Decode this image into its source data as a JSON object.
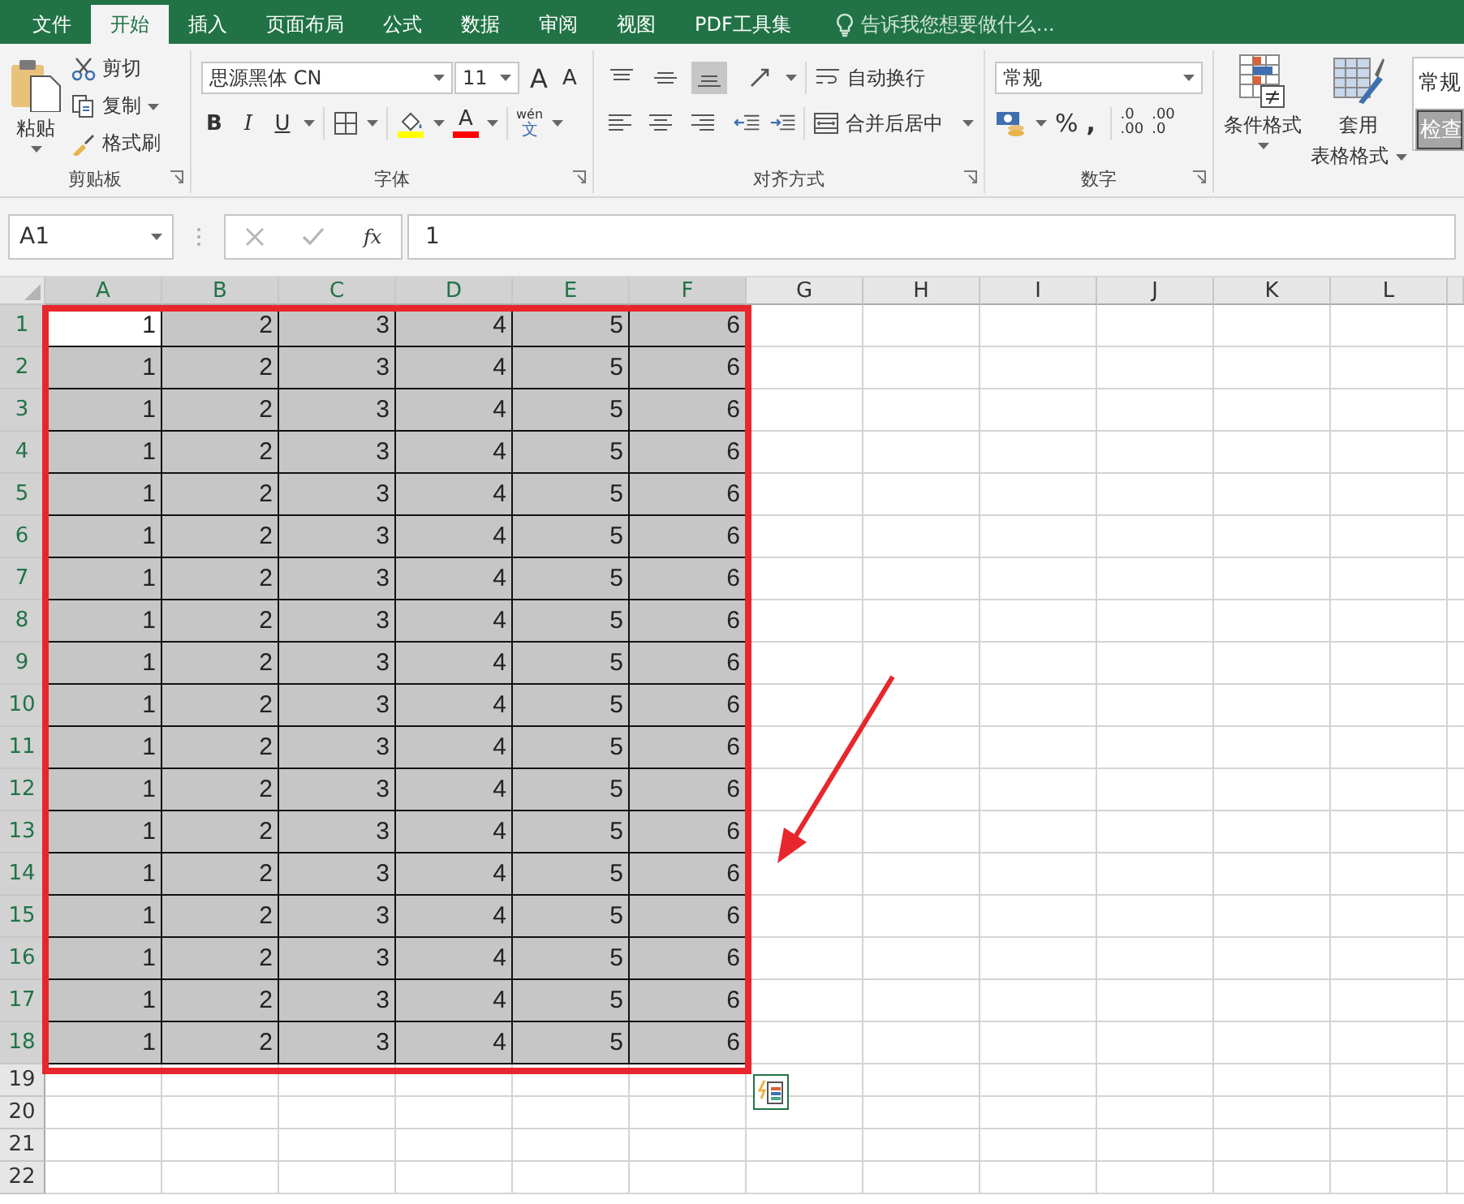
{
  "tabs": [
    {
      "label": "文件",
      "selected": false
    },
    {
      "label": "开始",
      "selected": true
    },
    {
      "label": "插入",
      "selected": false
    },
    {
      "label": "页面布局",
      "selected": false
    },
    {
      "label": "公式",
      "selected": false
    },
    {
      "label": "数据",
      "selected": false
    },
    {
      "label": "审阅",
      "selected": false
    },
    {
      "label": "视图",
      "selected": false
    },
    {
      "label": "PDF工具集",
      "selected": false
    }
  ],
  "tell_me": {
    "placeholder": "告诉我您想要做什么..."
  },
  "ribbon": {
    "clipboard": {
      "label": "剪贴板",
      "paste": "粘贴",
      "cut": "剪切",
      "copy": "复制",
      "format_painter": "格式刷"
    },
    "font": {
      "label": "字体",
      "font_name": "思源黑体 CN",
      "font_size": "11",
      "size_buttons": [
        "A",
        "A"
      ],
      "style_buttons": [
        "B",
        "I",
        "U"
      ],
      "font_color": {
        "label": "A"
      },
      "phonetic": {
        "top": "wén",
        "bottom": "文"
      }
    },
    "alignment": {
      "label": "对齐方式",
      "vertical_align": [
        {
          "selected": false
        },
        {
          "selected": false
        },
        {
          "selected": true
        }
      ],
      "horizontal_align": [
        {
          "selected": false
        },
        {
          "selected": false
        },
        {
          "selected": false
        }
      ],
      "wrap_text": "自动换行",
      "merge_center": "合并后居中"
    },
    "number": {
      "label": "数字",
      "format": "常规",
      "percent": "%",
      "comma": ",",
      "decimals": [
        {
          "top": ".0",
          "bottom": ".00"
        },
        {
          "top": ".00",
          "bottom": ".0"
        }
      ]
    },
    "styles": {
      "conditional": "条件格式",
      "table_format": [
        "套用",
        "表格格式"
      ],
      "cell_styles": [
        "常规",
        "检查"
      ]
    }
  },
  "formula_bar": {
    "name_box": "A1",
    "fx": "fx",
    "value": "1"
  },
  "sheet": {
    "columns": [
      {
        "label": "A",
        "selected": true
      },
      {
        "label": "B",
        "selected": true
      },
      {
        "label": "C",
        "selected": true
      },
      {
        "label": "D",
        "selected": true
      },
      {
        "label": "E",
        "selected": true
      },
      {
        "label": "F",
        "selected": true
      },
      {
        "label": "G",
        "selected": false
      },
      {
        "label": "H",
        "selected": false
      },
      {
        "label": "I",
        "selected": false
      },
      {
        "label": "J",
        "selected": false
      },
      {
        "label": "K",
        "selected": false
      },
      {
        "label": "L",
        "selected": false
      }
    ],
    "rows": [
      {
        "label": "1",
        "selected": true,
        "cells": [
          "1",
          "2",
          "3",
          "4",
          "5",
          "6"
        ]
      },
      {
        "label": "2",
        "selected": true,
        "cells": [
          "1",
          "2",
          "3",
          "4",
          "5",
          "6"
        ]
      },
      {
        "label": "3",
        "selected": true,
        "cells": [
          "1",
          "2",
          "3",
          "4",
          "5",
          "6"
        ]
      },
      {
        "label": "4",
        "selected": true,
        "cells": [
          "1",
          "2",
          "3",
          "4",
          "5",
          "6"
        ]
      },
      {
        "label": "5",
        "selected": true,
        "cells": [
          "1",
          "2",
          "3",
          "4",
          "5",
          "6"
        ]
      },
      {
        "label": "6",
        "selected": true,
        "cells": [
          "1",
          "2",
          "3",
          "4",
          "5",
          "6"
        ]
      },
      {
        "label": "7",
        "selected": true,
        "cells": [
          "1",
          "2",
          "3",
          "4",
          "5",
          "6"
        ]
      },
      {
        "label": "8",
        "selected": true,
        "cells": [
          "1",
          "2",
          "3",
          "4",
          "5",
          "6"
        ]
      },
      {
        "label": "9",
        "selected": true,
        "cells": [
          "1",
          "2",
          "3",
          "4",
          "5",
          "6"
        ]
      },
      {
        "label": "10",
        "selected": true,
        "cells": [
          "1",
          "2",
          "3",
          "4",
          "5",
          "6"
        ]
      },
      {
        "label": "11",
        "selected": true,
        "cells": [
          "1",
          "2",
          "3",
          "4",
          "5",
          "6"
        ]
      },
      {
        "label": "12",
        "selected": true,
        "cells": [
          "1",
          "2",
          "3",
          "4",
          "5",
          "6"
        ]
      },
      {
        "label": "13",
        "selected": true,
        "cells": [
          "1",
          "2",
          "3",
          "4",
          "5",
          "6"
        ]
      },
      {
        "label": "14",
        "selected": true,
        "cells": [
          "1",
          "2",
          "3",
          "4",
          "5",
          "6"
        ]
      },
      {
        "label": "15",
        "selected": true,
        "cells": [
          "1",
          "2",
          "3",
          "4",
          "5",
          "6"
        ]
      },
      {
        "label": "16",
        "selected": true,
        "cells": [
          "1",
          "2",
          "3",
          "4",
          "5",
          "6"
        ]
      },
      {
        "label": "17",
        "selected": true,
        "cells": [
          "1",
          "2",
          "3",
          "4",
          "5",
          "6"
        ]
      },
      {
        "label": "18",
        "selected": true,
        "cells": [
          "1",
          "2",
          "3",
          "4",
          "5",
          "6"
        ]
      },
      {
        "label": "19",
        "selected": false
      },
      {
        "label": "20",
        "selected": false
      },
      {
        "label": "21",
        "selected": false
      },
      {
        "label": "22",
        "selected": false
      }
    ]
  }
}
